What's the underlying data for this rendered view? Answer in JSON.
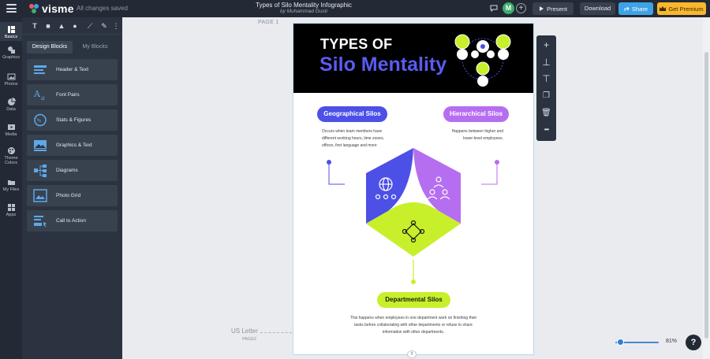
{
  "app": {
    "name": "visme",
    "save_status": "All changes saved"
  },
  "document": {
    "title": "Types of Silo Mentality Infographic",
    "author": "by Muhammad Gusti"
  },
  "header": {
    "avatar_initial": "M",
    "add_collab": "+",
    "present_label": "Present",
    "download_label": "Download",
    "share_label": "Share",
    "premium_label": "Get Premium"
  },
  "rail": [
    {
      "label": "Basics"
    },
    {
      "label": "Graphics"
    },
    {
      "label": "Photos"
    },
    {
      "label": "Data"
    },
    {
      "label": "Media"
    },
    {
      "label": "Theme Colors"
    },
    {
      "label": "My Files"
    },
    {
      "label": "Apps"
    }
  ],
  "panel": {
    "tools": [
      "T",
      "■",
      "▲",
      "●",
      "⟋",
      "✎",
      "⋮"
    ],
    "tabs": {
      "design_blocks": "Design Blocks",
      "my_blocks": "My Blocks"
    },
    "blocks": [
      {
        "label": "Header & Text"
      },
      {
        "label": "Font Pairs"
      },
      {
        "label": "Stats & Figures"
      },
      {
        "label": "Graphics & Text"
      },
      {
        "label": "Diagrams"
      },
      {
        "label": "Photo Grid"
      },
      {
        "label": "Call to Action"
      }
    ]
  },
  "canvas": {
    "page_label": "PAGE 1",
    "page_size": "US Letter",
    "page_next": "PAGE2",
    "zoom": "81%",
    "zoom_level": 0.1
  },
  "infographic": {
    "title_line1": "TYPES OF",
    "title_line2": "Silo Mentality",
    "geo": {
      "label": "Geographical Silos",
      "desc": "Occurs when team members have different working hours, time zones, offices, first language and more"
    },
    "hier": {
      "label": "Hierarchical Silos",
      "desc": "Happens between higher and lower-level employees."
    },
    "dept": {
      "label": "Departmental Silos",
      "desc": "This happens when employees in one department work on finishing their tasks before collaborating with other departments or refuse to share information  with other departments."
    },
    "colors": {
      "geo": "#4c50e6",
      "hier": "#b56ef0",
      "dept": "#c7f02a"
    }
  },
  "float_toolbar": [
    "+",
    "⊥",
    "⊤",
    "❐",
    "🗑",
    "•••"
  ],
  "help_label": "?"
}
